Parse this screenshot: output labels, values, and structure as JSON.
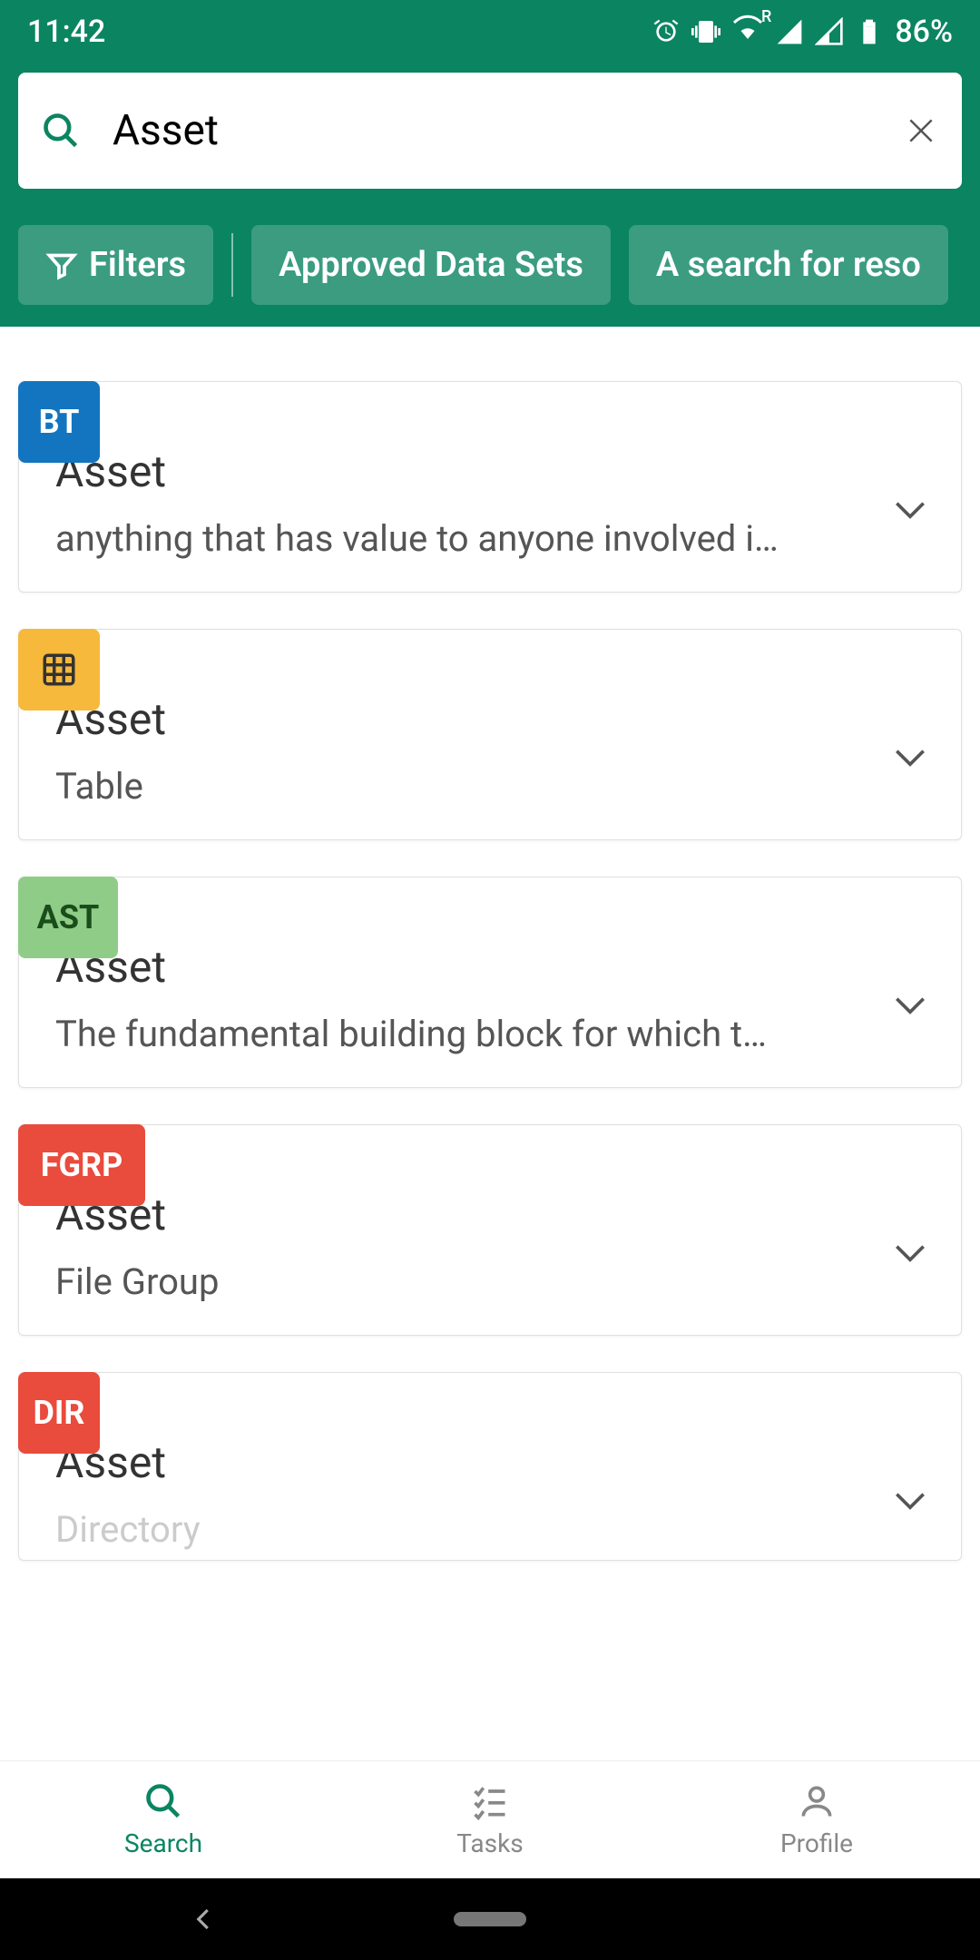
{
  "status": {
    "time": "11:42",
    "battery": "86%",
    "wifi_badge": "R"
  },
  "search": {
    "value": "Asset",
    "placeholder": "Search"
  },
  "filters": {
    "filters_label": "Filters",
    "chips": [
      "Approved Data Sets",
      "A search for reso"
    ]
  },
  "results": [
    {
      "badge": "BT",
      "badge_class": "bt",
      "title": "Asset",
      "desc": "anything that has value to anyone involved i…"
    },
    {
      "badge": "",
      "badge_class": "table",
      "title": "Asset",
      "desc": "Table"
    },
    {
      "badge": "AST",
      "badge_class": "ast",
      "title": "Asset",
      "desc": "The fundamental building block for which t…"
    },
    {
      "badge": "FGRP",
      "badge_class": "fgrp",
      "title": "Asset",
      "desc": "File Group"
    },
    {
      "badge": "DIR",
      "badge_class": "dir",
      "title": "Asset",
      "desc": "Directory"
    }
  ],
  "nav": {
    "search": "Search",
    "tasks": "Tasks",
    "profile": "Profile"
  },
  "colors": {
    "primary": "#0b8461"
  }
}
